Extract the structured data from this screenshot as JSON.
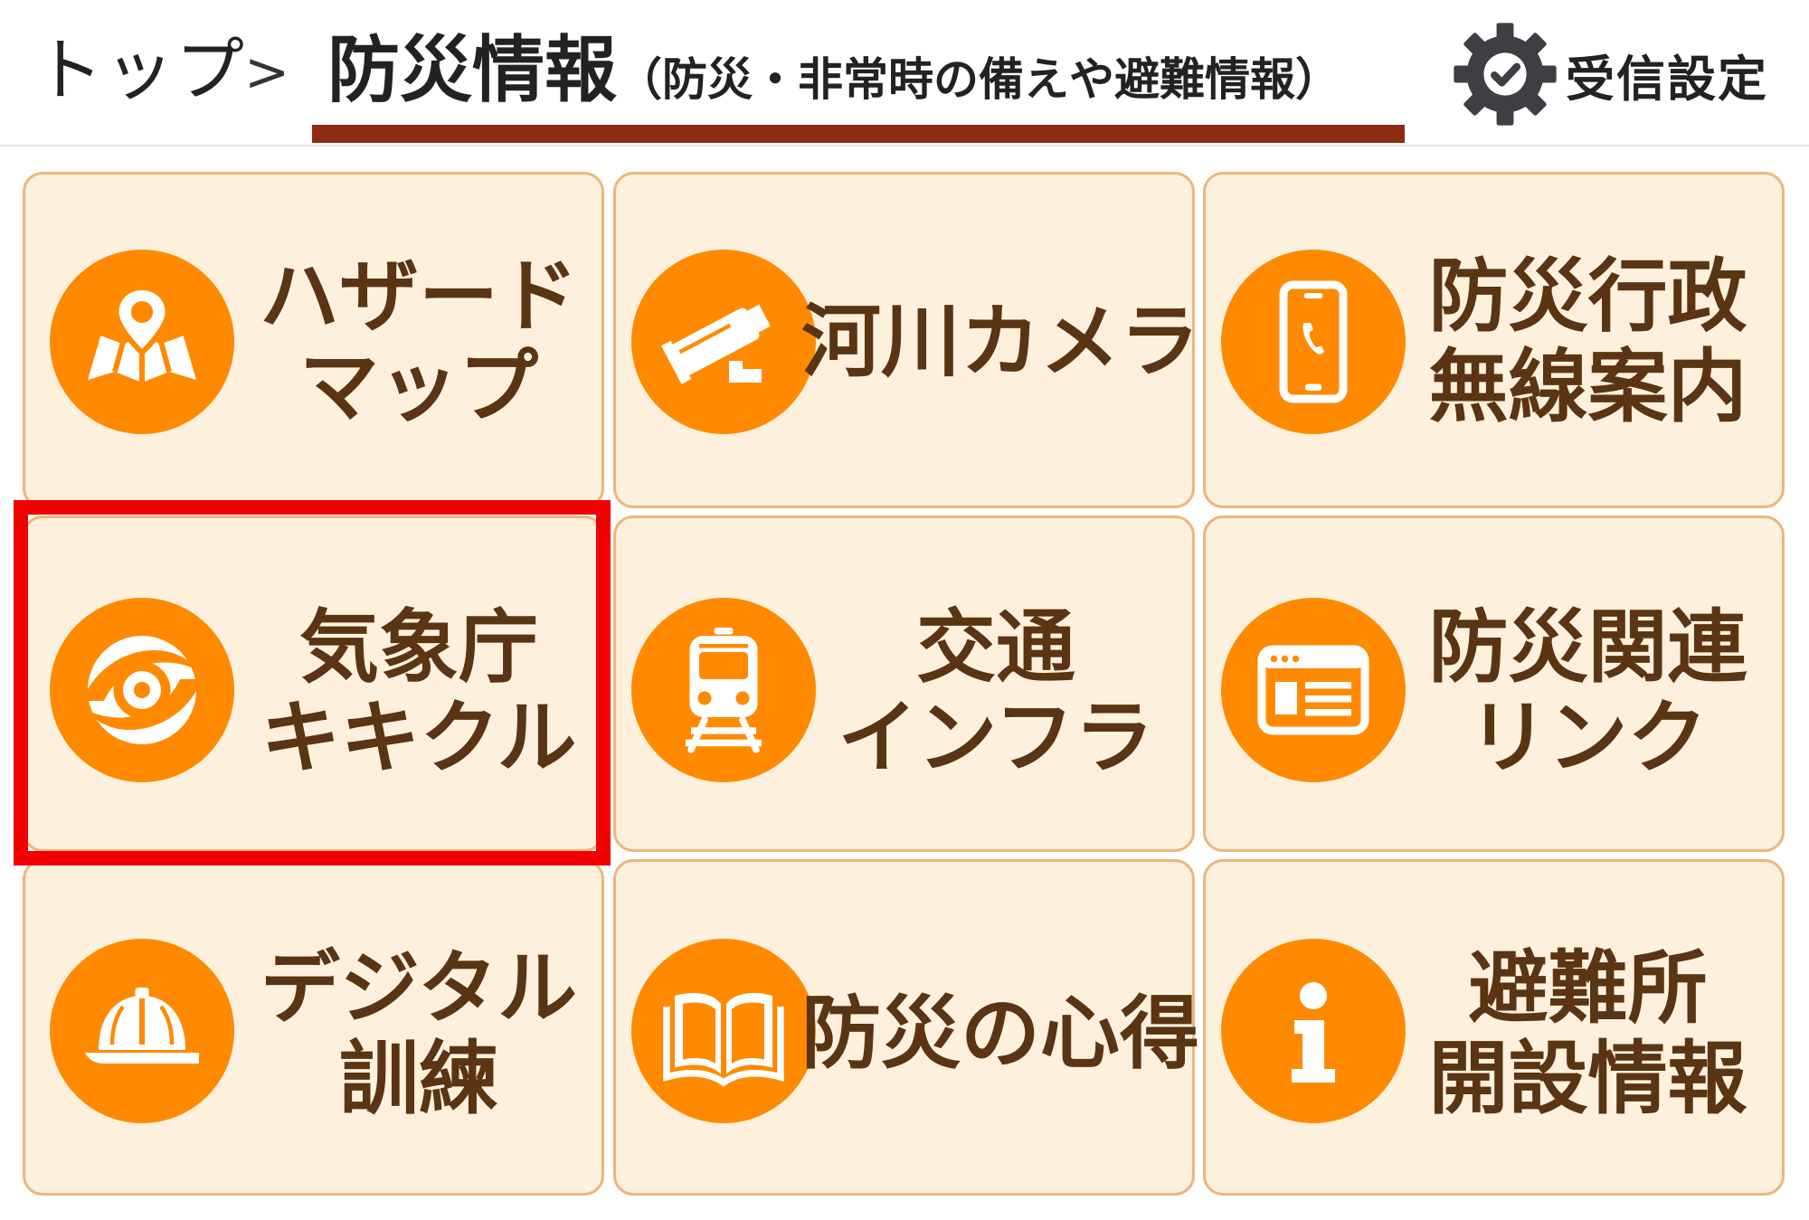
{
  "header": {
    "breadcrumb_top": "トップ",
    "breadcrumb_separator": ">",
    "current_title": "防災情報",
    "current_subtitle": "（防災・非常時の備えや避難情報）",
    "settings_label": "受信設定"
  },
  "tiles": [
    {
      "line1": "ハザード",
      "line2": "マップ",
      "icon": "map-pin-icon"
    },
    {
      "line1": "河川カメラ",
      "line2": "",
      "icon": "cctv-camera-icon"
    },
    {
      "line1": "防災行政",
      "line2": "無線案内",
      "icon": "smartphone-icon"
    },
    {
      "line1": "気象庁",
      "line2": "キキクル",
      "icon": "typhoon-icon"
    },
    {
      "line1": "交通",
      "line2": "インフラ",
      "icon": "train-icon"
    },
    {
      "line1": "防災関連",
      "line2": "リンク",
      "icon": "browser-window-icon"
    },
    {
      "line1": "デジタル",
      "line2": "訓練",
      "icon": "hard-hat-icon"
    },
    {
      "line1": "防災の心得",
      "line2": "",
      "icon": "open-book-icon"
    },
    {
      "line1": "避難所",
      "line2": "開設情報",
      "icon": "info-icon"
    }
  ],
  "colors": {
    "accent": "#ff8a00",
    "tile_bg": "#fdf1dd",
    "tile_border": "#eeb57b",
    "label_text": "#5a3413",
    "underline": "#8e2a12",
    "highlight": "#f00000"
  }
}
